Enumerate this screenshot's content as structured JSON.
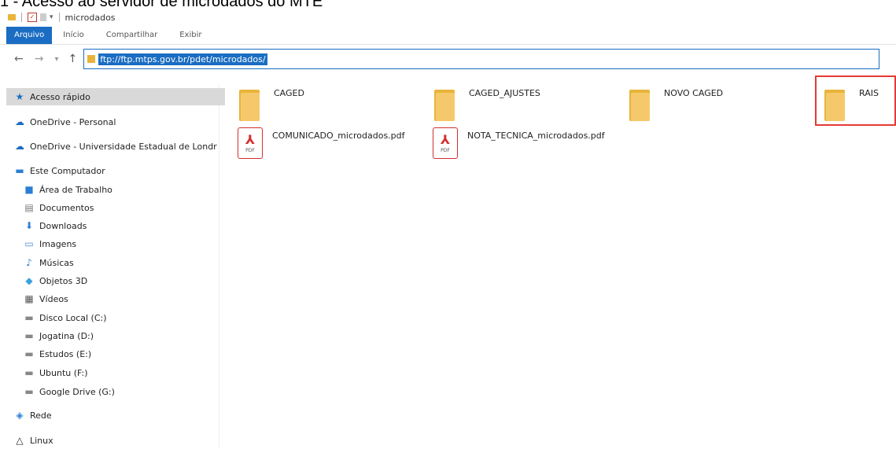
{
  "caption": "1 - Acesso ao servidor de microdados do MTE",
  "window": {
    "title": "microdados"
  },
  "ribbon": {
    "tabs": [
      "Arquivo",
      "Início",
      "Compartilhar",
      "Exibir"
    ]
  },
  "address": {
    "path": "ftp://ftp.mtps.gov.br/pdet/microdados/"
  },
  "sidebar": {
    "items": [
      {
        "label": "Acesso rápido",
        "icon": "star-icon",
        "selected": true
      },
      {
        "label": "OneDrive - Personal",
        "icon": "cloud-icon"
      },
      {
        "label": "OneDrive - Universidade Estadual de Londr",
        "icon": "cloud-icon"
      },
      {
        "label": "Este Computador",
        "icon": "computer-icon"
      },
      {
        "label": "Área de Trabalho",
        "icon": "desktop-icon"
      },
      {
        "label": "Documentos",
        "icon": "documents-icon"
      },
      {
        "label": "Downloads",
        "icon": "download-icon"
      },
      {
        "label": "Imagens",
        "icon": "images-icon"
      },
      {
        "label": "Músicas",
        "icon": "music-icon"
      },
      {
        "label": "Objetos 3D",
        "icon": "objects3d-icon"
      },
      {
        "label": "Vídeos",
        "icon": "videos-icon"
      },
      {
        "label": "Disco Local (C:)",
        "icon": "drive-icon"
      },
      {
        "label": "Jogatina (D:)",
        "icon": "drive-icon"
      },
      {
        "label": "Estudos (E:)",
        "icon": "drive-icon"
      },
      {
        "label": "Ubuntu (F:)",
        "icon": "drive-icon"
      },
      {
        "label": "Google Drive (G:)",
        "icon": "drive-icon"
      },
      {
        "label": "Rede",
        "icon": "network-icon"
      },
      {
        "label": "Linux",
        "icon": "linux-icon"
      }
    ]
  },
  "files": [
    {
      "name": "CAGED",
      "type": "folder"
    },
    {
      "name": "CAGED_AJUSTES",
      "type": "folder"
    },
    {
      "name": "NOVO CAGED",
      "type": "folder"
    },
    {
      "name": "RAIS",
      "type": "folder",
      "highlighted": true
    },
    {
      "name": "COMUNICADO_microdados.pdf",
      "type": "pdf"
    },
    {
      "name": "NOTA_TECNICA_microdados.pdf",
      "type": "pdf"
    }
  ],
  "pdf_icon_text": "PDF",
  "colors": {
    "accent": "#1a6dc2",
    "folder": "#e8b43a",
    "highlight": "#e53935",
    "pdf": "#d32f2f"
  }
}
